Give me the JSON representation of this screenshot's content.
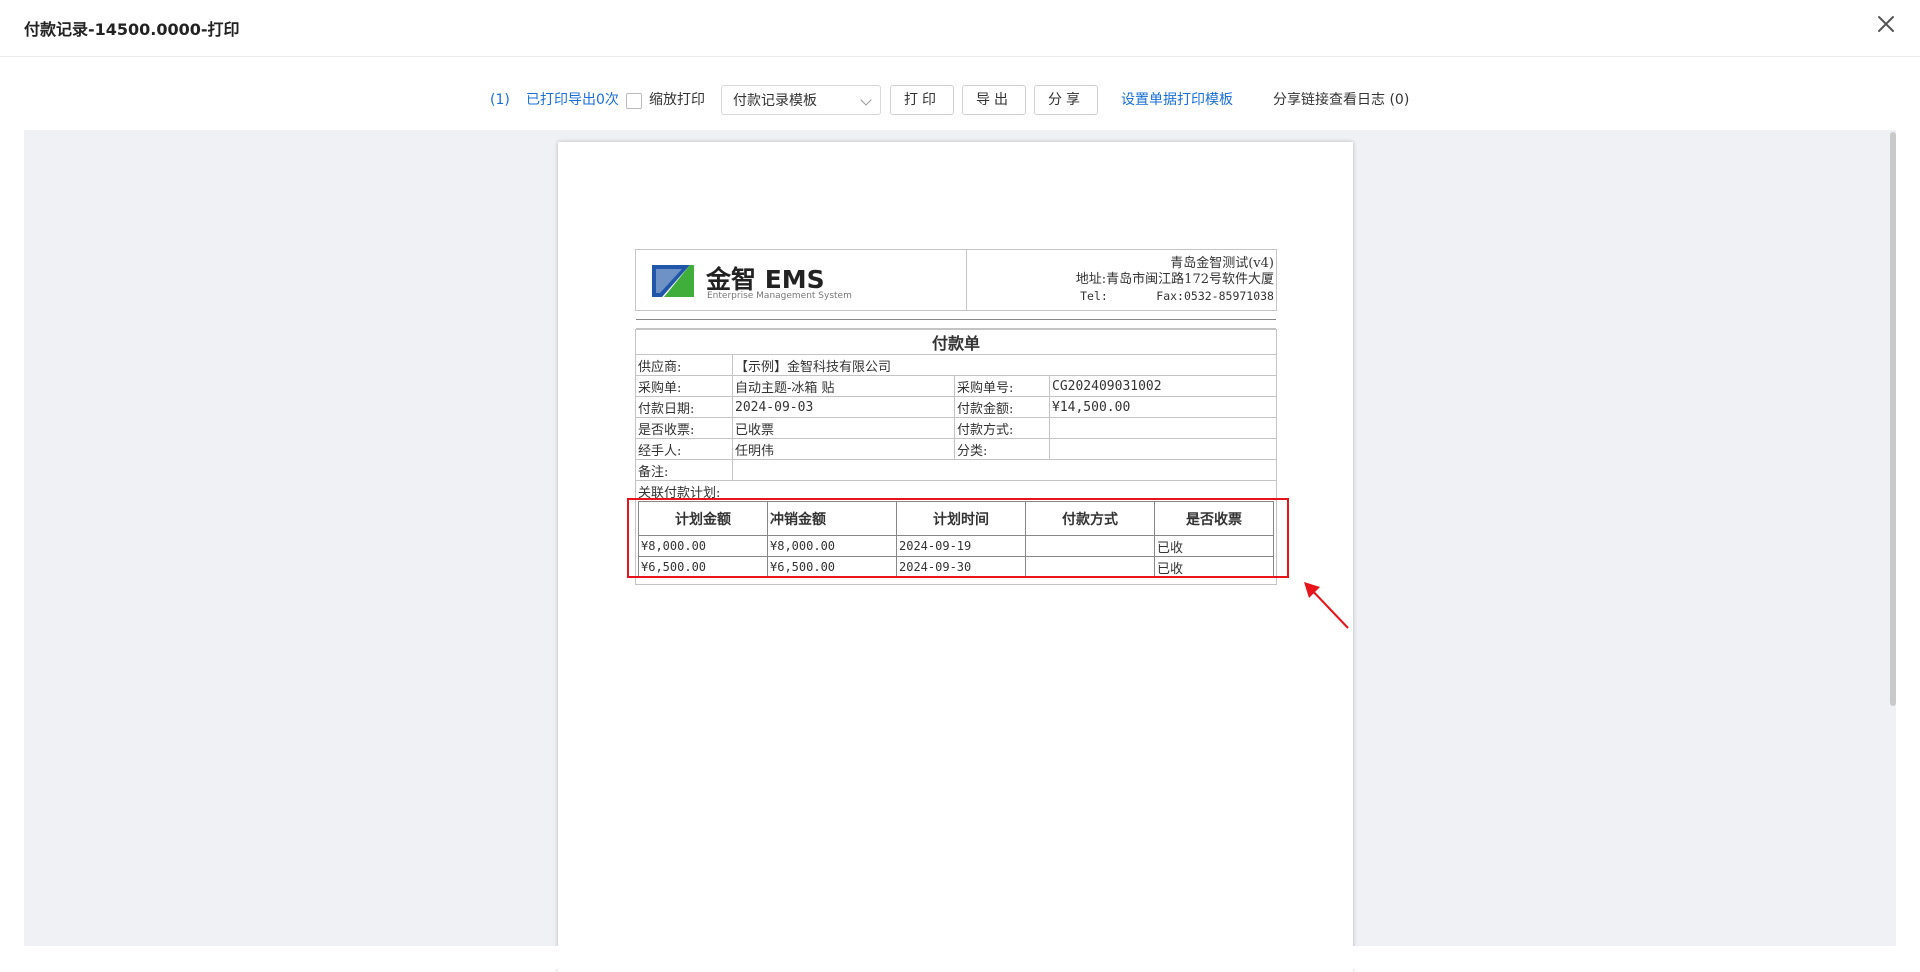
{
  "header": {
    "title": "付款记录-14500.0000-打印"
  },
  "toolbar": {
    "index": "(1)",
    "print_count": "已打印导出0次",
    "scale_print": "缩放打印",
    "template_select": "付款记录模板",
    "print_btn": "打印",
    "export_btn": "导出",
    "share_btn": "分享",
    "set_template_link": "设置单据打印模板",
    "share_log": "分享链接查看日志 (0)"
  },
  "document": {
    "logo_brand": "金智 EMS",
    "logo_sub": "Enterprise Management System",
    "company": "青岛金智测试(v4)",
    "address": "地址:青岛市闽江路172号软件大厦",
    "tel_fax": "Tel:       Fax:0532-85971038",
    "title": "付款单",
    "supplier_label": "供应商:",
    "supplier_value": "【示例】金智科技有限公司",
    "po_label": "采购单:",
    "po_value": "自动主题-冰箱 贴",
    "po_no_label": "采购单号:",
    "po_no_value": "CG202409031002",
    "pay_date_label": "付款日期:",
    "pay_date_value": "2024-09-03",
    "pay_amount_label": "付款金额:",
    "pay_amount_value": "¥14,500.00",
    "invoice_label": "是否收票:",
    "invoice_value": "已收票",
    "pay_method_label": "付款方式:",
    "pay_method_value": "",
    "handler_label": "经手人:",
    "handler_value": "任明伟",
    "category_label": "分类:",
    "category_value": "",
    "remark_label": "备注:",
    "remark_value": "",
    "plan_label": "关联付款计划:",
    "plan_headers": [
      "计划金额",
      "冲销金额",
      "计划时间",
      "付款方式",
      "是否收票"
    ],
    "plan_rows": [
      [
        "¥8,000.00",
        "¥8,000.00",
        "2024-09-19",
        "",
        "已收"
      ],
      [
        "¥6,500.00",
        "¥6,500.00",
        "2024-09-30",
        "",
        "已收"
      ]
    ]
  },
  "colors": {
    "link": "#1a6fd6",
    "highlight": "#e8141c",
    "logo_green": "#3fae3a",
    "logo_blue": "#2157a8"
  }
}
